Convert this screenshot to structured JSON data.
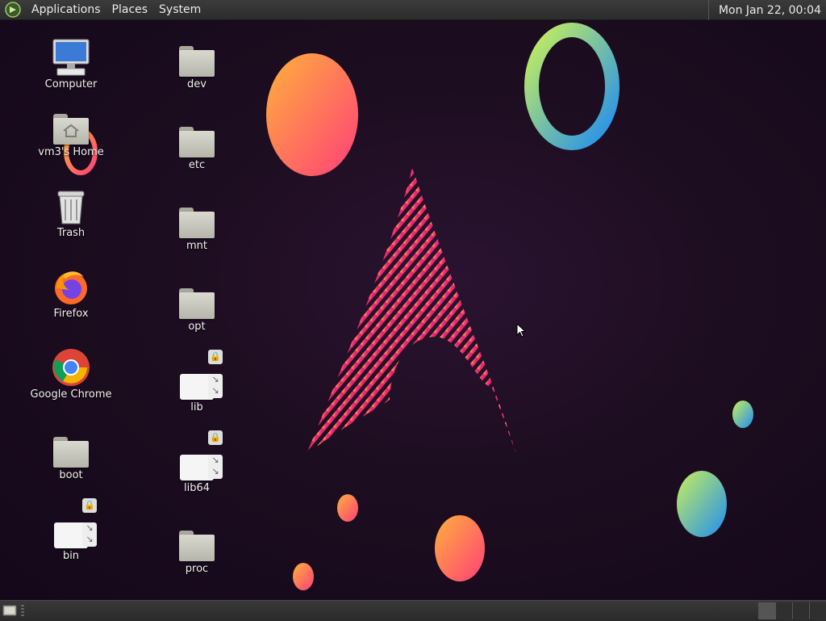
{
  "top_panel": {
    "menus": [
      "Applications",
      "Places",
      "System"
    ],
    "clock": "Mon Jan 22, 00:04"
  },
  "desktop_icons": {
    "computer": "Computer",
    "home": "vm3's Home",
    "trash": "Trash",
    "firefox": "Firefox",
    "chrome": "Google Chrome",
    "boot": "boot",
    "bin": "bin",
    "dev": "dev",
    "etc": "etc",
    "mnt": "mnt",
    "opt": "opt",
    "lib": "lib",
    "lib64": "lib64",
    "proc": "proc"
  },
  "icons": {
    "computer": "computer-icon",
    "home": "home-folder-icon",
    "trash": "trash-icon",
    "firefox": "firefox-icon",
    "chrome": "chrome-icon",
    "folder": "folder-icon",
    "symlink": "symlink-icon",
    "lock": "lock-icon"
  },
  "colors": {
    "panel": "#2f2f2f",
    "desktop": "#1d0d20",
    "accent_pink": "#e6286e",
    "accent_orange": "#ff9a3c"
  }
}
